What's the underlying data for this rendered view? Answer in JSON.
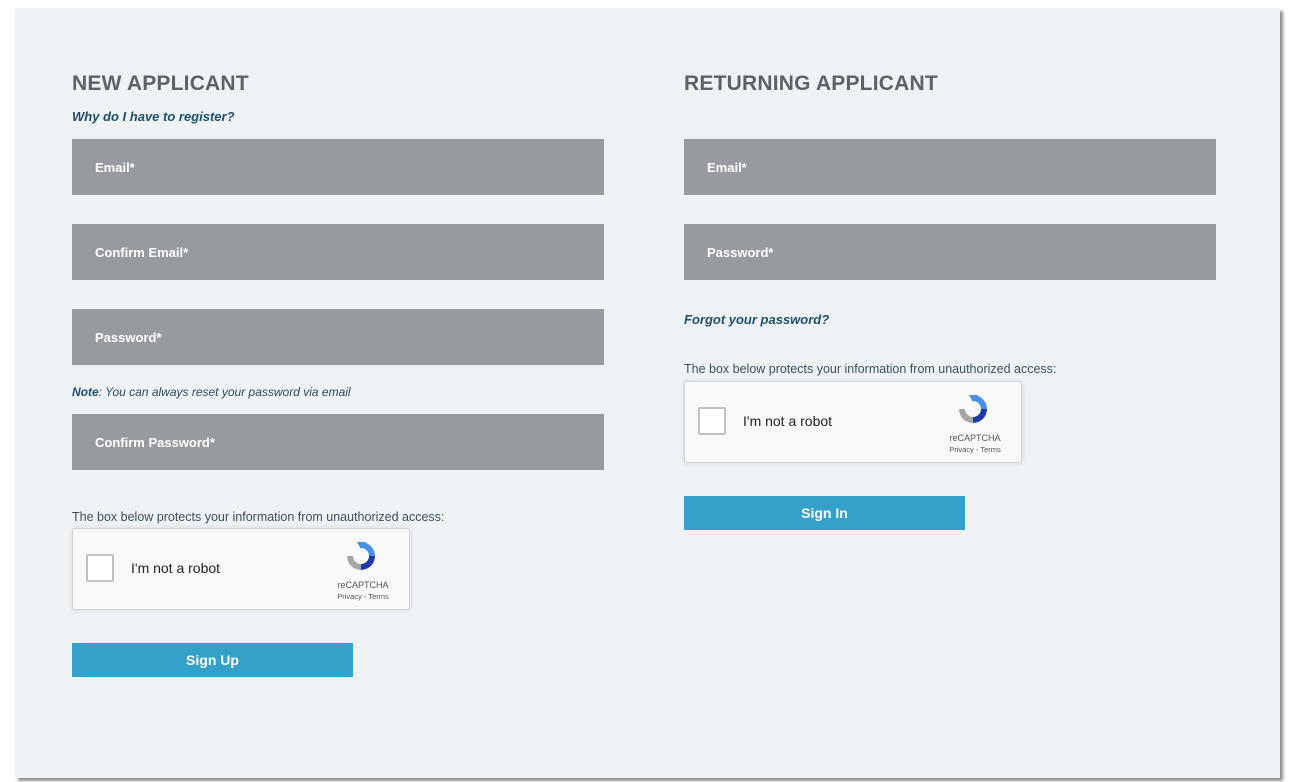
{
  "new_applicant": {
    "heading": "NEW APPLICANT",
    "why_register_link": "Why do I have to register?",
    "email_placeholder": "Email*",
    "confirm_email_placeholder": "Confirm Email*",
    "password_placeholder": "Password*",
    "note_label": "Note",
    "note_text": ": You can always reset your password via email",
    "confirm_password_placeholder": "Confirm Password*",
    "protect_text": "The box below protects your information from unauthorized access:",
    "captcha": {
      "label": "I'm not a robot",
      "brand": "reCAPTCHA",
      "terms": "Privacy - Terms"
    },
    "submit_label": "Sign Up"
  },
  "returning_applicant": {
    "heading": "RETURNING APPLICANT",
    "email_placeholder": "Email*",
    "password_placeholder": "Password*",
    "forgot_link": "Forgot your password?",
    "protect_text": "The box below protects your information from unauthorized access:",
    "captcha": {
      "label": "I'm not a robot",
      "brand": "reCAPTCHA",
      "terms": "Privacy - Terms"
    },
    "submit_label": "Sign In"
  },
  "colors": {
    "panel_bg": "#eff3f6",
    "field_bg": "#979b9f",
    "button_bg": "#34a1cb",
    "heading": "#5e6266",
    "link": "#1d4f6e"
  },
  "icons": {
    "captcha_logo": "recaptcha-logo-icon"
  }
}
